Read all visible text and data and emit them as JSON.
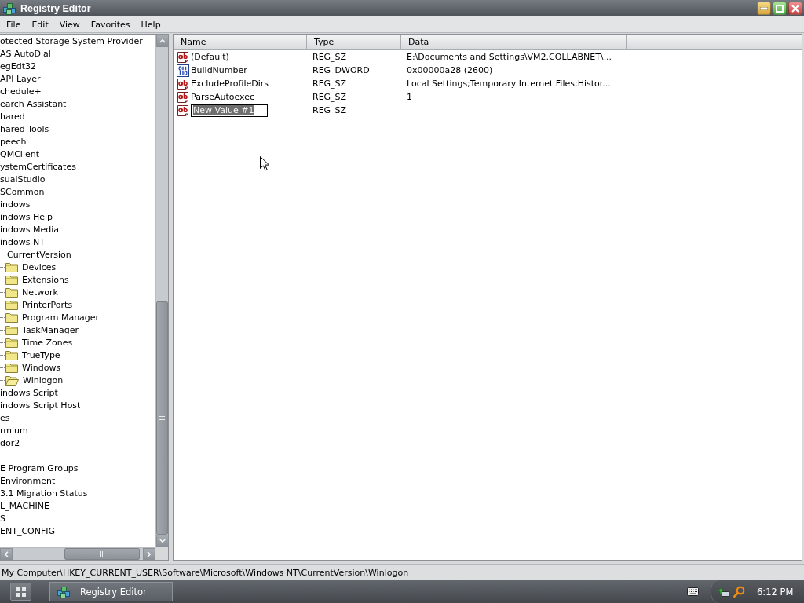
{
  "window": {
    "title": "Registry Editor"
  },
  "menu": [
    "File",
    "Edit",
    "View",
    "Favorites",
    "Help"
  ],
  "tree": {
    "items": [
      {
        "kind": "key",
        "label": "otected Storage System Provider"
      },
      {
        "kind": "key",
        "label": "AS AutoDial"
      },
      {
        "kind": "key",
        "label": "egEdt32"
      },
      {
        "kind": "key",
        "label": "API Layer"
      },
      {
        "kind": "key",
        "label": "chedule+"
      },
      {
        "kind": "key",
        "label": "earch Assistant"
      },
      {
        "kind": "key",
        "label": "hared"
      },
      {
        "kind": "key",
        "label": "hared Tools"
      },
      {
        "kind": "key",
        "label": "peech"
      },
      {
        "kind": "key",
        "label": "QMClient"
      },
      {
        "kind": "key",
        "label": "ystemCertificates"
      },
      {
        "kind": "key",
        "label": "sualStudio"
      },
      {
        "kind": "key",
        "label": "SCommon"
      },
      {
        "kind": "key",
        "label": "indows"
      },
      {
        "kind": "key",
        "label": "indows Help"
      },
      {
        "kind": "key",
        "label": "indows Media"
      },
      {
        "kind": "key",
        "label": "indows NT"
      },
      {
        "kind": "key",
        "label": "CurrentVersion",
        "children": [
          {
            "label": "Devices",
            "open": false
          },
          {
            "label": "Extensions",
            "open": false
          },
          {
            "label": "Network",
            "open": false
          },
          {
            "label": "PrinterPorts",
            "open": false
          },
          {
            "label": "Program Manager",
            "open": false
          },
          {
            "label": "TaskManager",
            "open": false
          },
          {
            "label": "Time Zones",
            "open": false
          },
          {
            "label": "TrueType",
            "open": false
          },
          {
            "label": "Windows",
            "open": false
          },
          {
            "label": "Winlogon",
            "open": true
          }
        ]
      },
      {
        "kind": "key",
        "label": "indows Script"
      },
      {
        "kind": "key",
        "label": "indows Script Host"
      },
      {
        "kind": "key",
        "label": "es"
      },
      {
        "kind": "key",
        "label": "rmium"
      },
      {
        "kind": "key",
        "label": "dor2"
      },
      {
        "kind": "blank"
      },
      {
        "kind": "key",
        "label": "E Program Groups"
      },
      {
        "kind": "key",
        "label": "Environment"
      },
      {
        "kind": "key",
        "label": "3.1 Migration Status"
      },
      {
        "kind": "key",
        "label": "L_MACHINE"
      },
      {
        "kind": "key",
        "label": "S"
      },
      {
        "kind": "key",
        "label": "ENT_CONFIG"
      }
    ]
  },
  "values": {
    "columns": [
      "Name",
      "Type",
      "Data"
    ],
    "rows": [
      {
        "kind": "string",
        "name": "(Default)",
        "type": "REG_SZ",
        "data": "E:\\Documents and Settings\\VM2.COLLABNET\\...",
        "editing": false
      },
      {
        "kind": "dword",
        "name": "BuildNumber",
        "type": "REG_DWORD",
        "data": "0x00000a28 (2600)",
        "editing": false
      },
      {
        "kind": "string",
        "name": "ExcludeProfileDirs",
        "type": "REG_SZ",
        "data": "Local Settings;Temporary Internet Files;Histor...",
        "editing": false
      },
      {
        "kind": "string",
        "name": "ParseAutoexec",
        "type": "REG_SZ",
        "data": "1",
        "editing": false
      },
      {
        "kind": "string",
        "name": "New Value #1",
        "type": "REG_SZ",
        "editing": true
      }
    ]
  },
  "status_bar": "My Computer\\HKEY_CURRENT_USER\\Software\\Microsoft\\Windows NT\\CurrentVersion\\Winlogon",
  "taskbar": {
    "buttons": [
      {
        "label": "Registry Editor",
        "selected": true
      }
    ],
    "clock": "6:12 PM"
  }
}
